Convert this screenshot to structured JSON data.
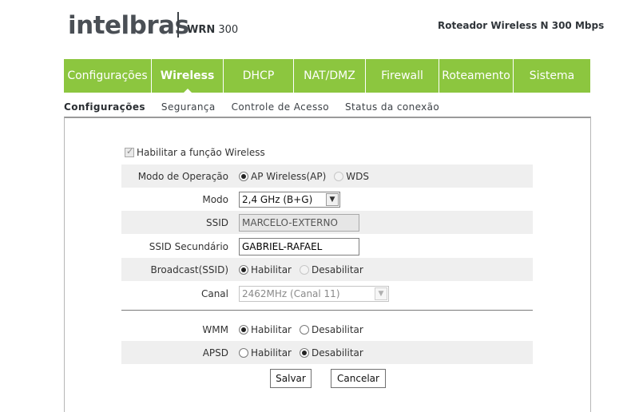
{
  "header": {
    "logo": "intelbras",
    "model_prefix": "WRN",
    "model_number": "300",
    "product_title": "Roteador Wireless N 300 Mbps"
  },
  "nav": {
    "items": [
      "Configurações",
      "Wireless",
      "DHCP",
      "NAT/DMZ",
      "Firewall",
      "Roteamento",
      "Sistema"
    ],
    "active": "Wireless"
  },
  "subnav": {
    "items": [
      "Configurações",
      "Segurança",
      "Controle de Acesso",
      "Status da conexão"
    ],
    "active": "Configurações"
  },
  "form": {
    "enable_wireless": {
      "label": "Habilitar a função Wireless",
      "checked": true,
      "disabled": true
    },
    "mode_operation": {
      "label": "Modo de Operação",
      "option_ap": "AP Wireless(AP)",
      "option_wds": "WDS",
      "selected": "ap"
    },
    "mode": {
      "label": "Modo",
      "value": "2,4 GHz (B+G)"
    },
    "ssid": {
      "label": "SSID",
      "value": "MARCELO-EXTERNO"
    },
    "ssid_secondary": {
      "label": "SSID Secundário",
      "value": "GABRIEL-RAFAEL"
    },
    "broadcast": {
      "label": "Broadcast(SSID)",
      "option_on": "Habilitar",
      "option_off": "Desabilitar",
      "selected": "on"
    },
    "channel": {
      "label": "Canal",
      "value": "2462MHz (Canal 11)"
    },
    "wmm": {
      "label": "WMM",
      "option_on": "Habilitar",
      "option_off": "Desabilitar",
      "selected": "on"
    },
    "apsd": {
      "label": "APSD",
      "option_on": "Habilitar",
      "option_off": "Desabilitar",
      "selected": "off"
    }
  },
  "buttons": {
    "save": "Salvar",
    "cancel": "Cancelar"
  },
  "colors": {
    "nav_green": "#8cc63f",
    "row_shade": "#efefef",
    "text": "#333333"
  }
}
